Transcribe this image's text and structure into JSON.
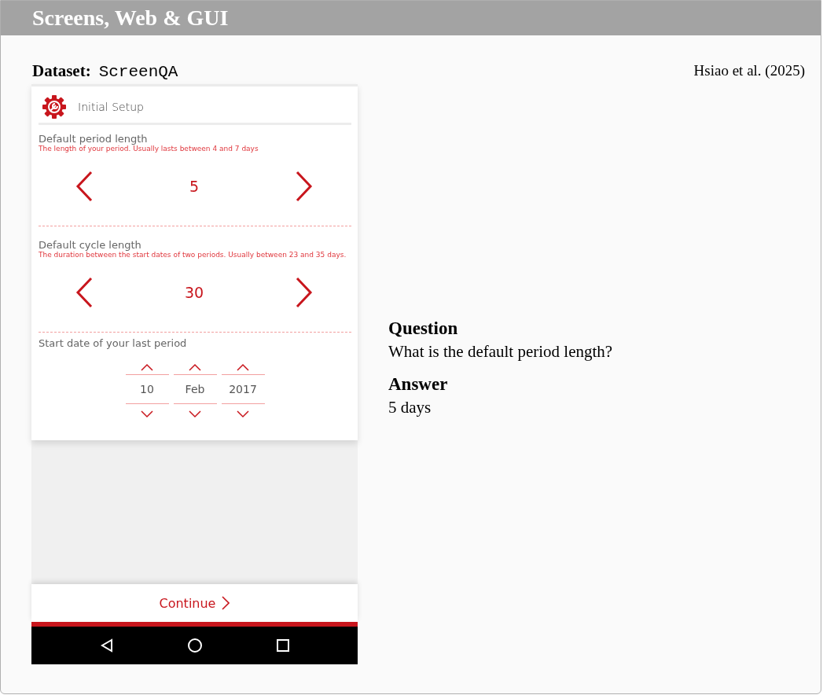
{
  "header": {
    "title": "Screens, Web & GUI"
  },
  "dataset": {
    "label": "Dataset:",
    "name": "ScreenQA",
    "citation": "Hsiao et al. (2025)"
  },
  "app": {
    "title": "Initial Setup",
    "steppers": [
      {
        "label": "Default period length",
        "hint": "The length of your period. Usually lasts between 4 and 7 days",
        "value": "5"
      },
      {
        "label": "Default cycle length",
        "hint": "The duration between the start dates of two periods. Usually between 23 and 35 days.",
        "value": "30"
      }
    ],
    "date": {
      "label": "Start date of your last period",
      "parts": [
        "10",
        "Feb",
        "2017"
      ]
    },
    "continue": "Continue"
  },
  "qa": [
    {
      "heading": "Question",
      "text": "What is the default period length?"
    },
    {
      "heading": "Answer",
      "text": "5 days"
    }
  ]
}
